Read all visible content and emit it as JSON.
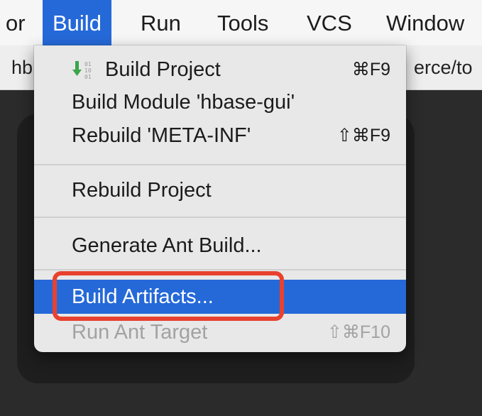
{
  "menubar": {
    "items": [
      {
        "label": "or"
      },
      {
        "label": "Build"
      },
      {
        "label": "Run"
      },
      {
        "label": "Tools"
      },
      {
        "label": "VCS"
      },
      {
        "label": "Window"
      }
    ]
  },
  "pathbar": {
    "left_fragment": "hb",
    "right_fragment": "erce/to"
  },
  "build_menu": {
    "items": [
      {
        "label": "Build Project",
        "shortcut": "⌘F9",
        "icon": "build-project-icon"
      },
      {
        "label": "Build Module 'hbase-gui'",
        "shortcut": ""
      },
      {
        "label": "Rebuild 'META-INF'",
        "shortcut": "⇧⌘F9"
      },
      {
        "label": "Rebuild Project",
        "shortcut": ""
      },
      {
        "label": "Generate Ant Build...",
        "shortcut": ""
      },
      {
        "label": "Build Artifacts...",
        "shortcut": "",
        "state": "highlighted"
      },
      {
        "label": "Run Ant Target",
        "shortcut": "⇧⌘F10",
        "state": "disabled"
      }
    ]
  },
  "colors": {
    "accent": "#2569d8",
    "callout": "#e8422e",
    "editor_bg": "#2b2b2b"
  }
}
